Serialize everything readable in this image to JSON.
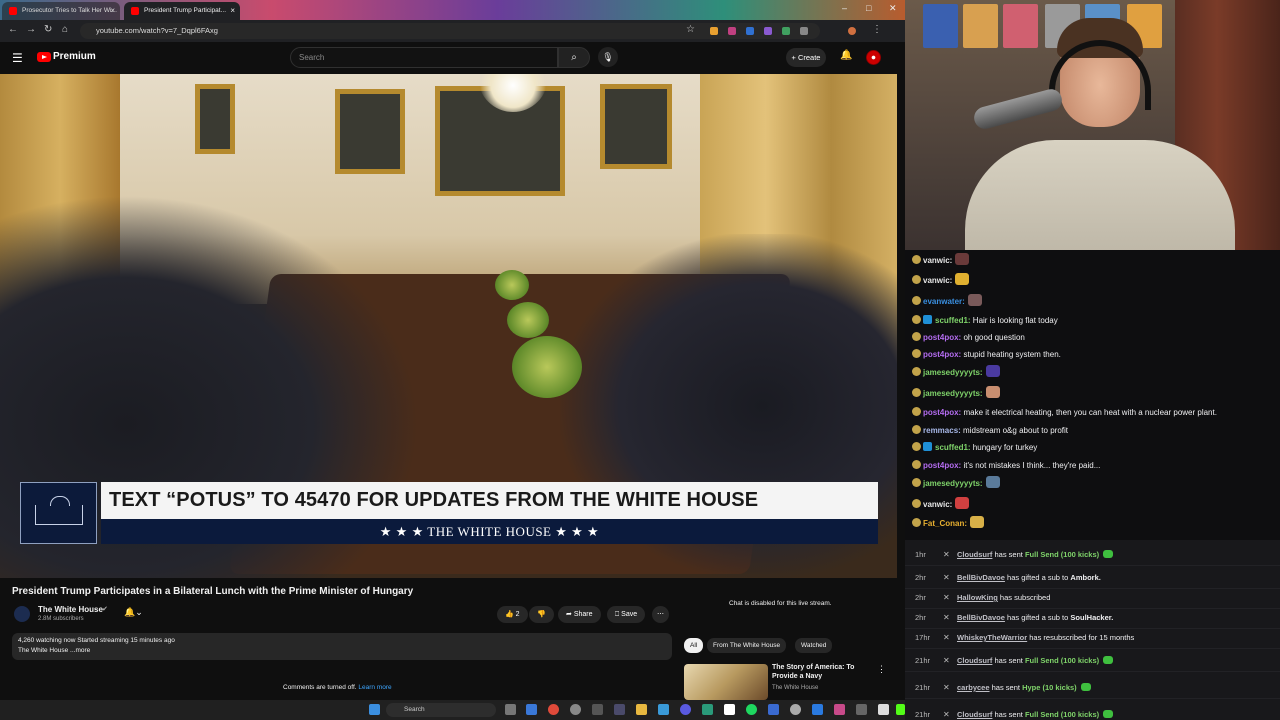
{
  "browser": {
    "tabs": [
      {
        "label": "Prosecutor Tries to Talk Her Wi..."
      },
      {
        "label": "President Trump Participat..."
      }
    ],
    "url": "youtube.com/watch?v=7_Dqpl6FAxg"
  },
  "youtube": {
    "logo_text": "Premium",
    "search_placeholder": "Search",
    "create_label": "Create",
    "video": {
      "lower_third_text": "TEXT “POTUS” TO 45470 FOR UPDATES FROM THE WHITE HOUSE",
      "lower_third_sub": "★ ★ ★  THE WHITE HOUSE  ★ ★ ★"
    },
    "title": "President Trump Participates in a Bilateral Lunch with the Prime Minister of Hungary",
    "channel": {
      "name": "The White House",
      "subscribers": "2.8M subscribers"
    },
    "actions": {
      "likes": "2",
      "share": "Share",
      "save": "Save"
    },
    "description": {
      "stats": "4,260 watching now  Started streaming 15 minutes ago",
      "line": "The White House ...more"
    },
    "comments_notice": "Comments are turned off.",
    "learn_more": "Learn more",
    "chat_disabled": "Chat is disabled for this live stream.",
    "chips": [
      "All",
      "From The White House",
      "Watched"
    ],
    "recommended": {
      "title": "The Story of America: To Provide a Navy",
      "channel": "The White House"
    }
  },
  "chat": [
    {
      "user": "vanwic:",
      "color": "#e6e6e6",
      "text": "",
      "emote": "#6a3a3a"
    },
    {
      "user": "vanwic:",
      "color": "#e6e6e6",
      "text": "",
      "emote": "#e0b030"
    },
    {
      "user": "evanwater:",
      "color": "#3a8fe0",
      "text": "",
      "emote": "#7a5a5a"
    },
    {
      "user": "scuffed1:",
      "color": "#7fd36a",
      "text": "Hair is looking flat today",
      "emote": ""
    },
    {
      "user": "post4pox:",
      "color": "#b46cf0",
      "text": "oh good question",
      "emote": ""
    },
    {
      "user": "post4pox:",
      "color": "#b46cf0",
      "text": "stupid heating system then.",
      "emote": ""
    },
    {
      "user": "jamesedyyyyts:",
      "color": "#7fd36a",
      "text": "",
      "emote": "#4a3aa0"
    },
    {
      "user": "jamesedyyyyts:",
      "color": "#7fd36a",
      "text": "",
      "emote": "#c88e70"
    },
    {
      "user": "post4pox:",
      "color": "#b46cf0",
      "text": "make it electrical heating, then you can heat with a nuclear power plant.",
      "emote": ""
    },
    {
      "user": "remmacs:",
      "color": "#a8b8e8",
      "text": "midstream o&g about to profit",
      "emote": ""
    },
    {
      "user": "scuffed1:",
      "color": "#7fd36a",
      "text": "hungary for turkey",
      "emote": ""
    },
    {
      "user": "post4pox:",
      "color": "#b46cf0",
      "text": "it's not mistakes I think... they're paid...",
      "emote": ""
    },
    {
      "user": "jamesedyyyyts:",
      "color": "#7fd36a",
      "text": "",
      "emote": "#5a7a9a"
    },
    {
      "user": "vanwic:",
      "color": "#e6e6e6",
      "text": "",
      "emote": "#d04040"
    },
    {
      "user": "Fat_Conan:",
      "color": "#e8b030",
      "text": "",
      "emote": "#d8b048"
    }
  ],
  "activity": [
    {
      "time": "1hr",
      "user": "Cloudsurf",
      "pre": " has sent ",
      "highlight": "Full Send (100 kicks)",
      "post": "",
      "gem": true
    },
    {
      "time": "2hr",
      "user": "BellBivDavoe",
      "pre": " has gifted a sub to ",
      "highlight": "",
      "post": "Ambork.",
      "gem": false
    },
    {
      "time": "2hr",
      "user": "HallowKing",
      "pre": " has subscribed",
      "highlight": "",
      "post": "",
      "gem": false
    },
    {
      "time": "2hr",
      "user": "BellBivDavoe",
      "pre": " has gifted a sub to ",
      "highlight": "",
      "post": "SoulHacker.",
      "gem": false
    },
    {
      "time": "17hr",
      "user": "WhiskeyTheWarrior",
      "pre": " has resubscribed for 15 months",
      "highlight": "",
      "post": "",
      "gem": false
    },
    {
      "time": "21hr",
      "user": "Cloudsurf",
      "pre": " has sent ",
      "highlight": "Full Send (100 kicks)",
      "post": "",
      "gem": true
    },
    {
      "time": "21hr",
      "user": "carbycee",
      "pre": " has sent ",
      "highlight": "Hype (10 kicks)",
      "post": "",
      "gem": true
    },
    {
      "time": "21hr",
      "user": "Cloudsurf",
      "pre": " has sent ",
      "highlight": "Full Send (100 kicks)",
      "post": "",
      "gem": true
    }
  ],
  "taskbar": {
    "search_label": "Search"
  }
}
